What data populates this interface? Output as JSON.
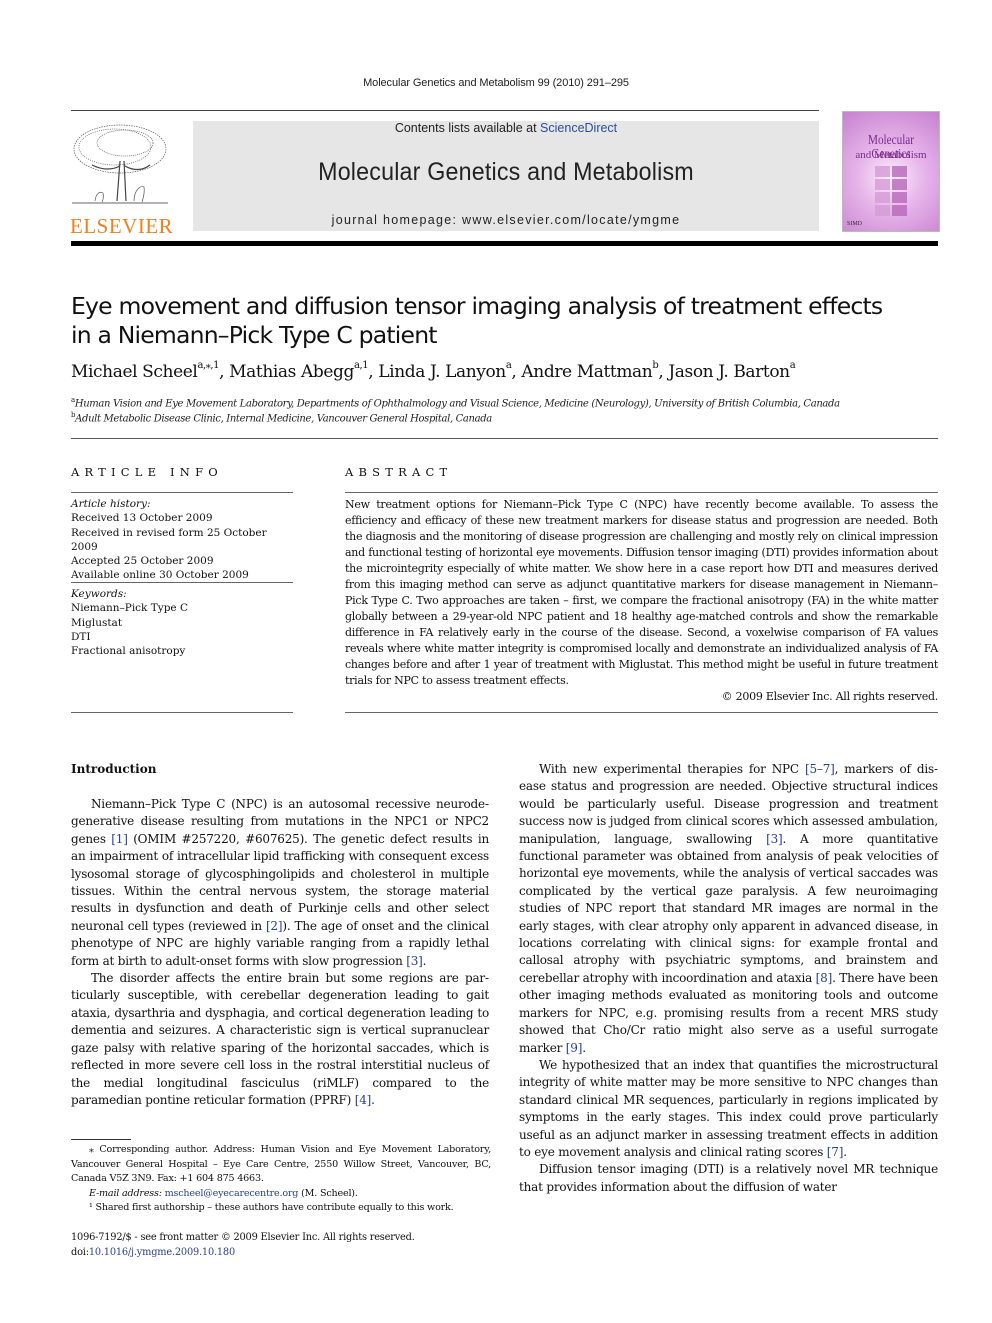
{
  "running_head": "Molecular Genetics and Metabolism 99 (2010) 291–295",
  "masthead": {
    "publisher_logo_text": "ELSEVIER",
    "contents_prefix": "Contents lists available at ",
    "contents_link": "ScienceDirect",
    "journal_title": "Molecular Genetics and Metabolism",
    "homepage": "journal homepage: www.elsevier.com/locate/ymgme",
    "cover": {
      "title_line1": "Molecular Genetics",
      "title_line2": "and Metabolism",
      "society": "SIMD",
      "accent_color": "#c77fd0"
    },
    "colors": {
      "elsevier_orange": "#f07f1e",
      "banner_gray": "#e6e6e6",
      "link_blue": "#2a3f8f"
    }
  },
  "article": {
    "title_line1": "Eye movement and diffusion tensor imaging analysis of treatment effects",
    "title_line2": "in a Niemann–Pick Type C patient",
    "authors": [
      {
        "name": "Michael Scheel",
        "sup": "a,⁎,1",
        "sep": ", "
      },
      {
        "name": "Mathias Abegg",
        "sup": "a,1",
        "sep": ", "
      },
      {
        "name": "Linda J. Lanyon",
        "sup": "a",
        "sep": ", "
      },
      {
        "name": "Andre Mattman",
        "sup": "b",
        "sep": ", "
      },
      {
        "name": "Jason J. Barton",
        "sup": "a",
        "sep": ""
      }
    ],
    "affiliations": [
      {
        "mark": "a",
        "text": "Human Vision and Eye Movement Laboratory, Departments of Ophthalmology and Visual Science, Medicine (Neurology), University of British Columbia, Canada"
      },
      {
        "mark": "b",
        "text": "Adult Metabolic Disease Clinic, Internal Medicine, Vancouver General Hospital, Canada"
      }
    ]
  },
  "article_info": {
    "heading": "ARTICLE INFO",
    "history_label": "Article history:",
    "history": [
      "Received 13 October 2009",
      "Received in revised form 25 October 2009",
      "Accepted 25 October 2009",
      "Available online 30 October 2009"
    ],
    "keywords_label": "Keywords:",
    "keywords": [
      "Niemann–Pick Type C",
      "Miglustat",
      "DTI",
      "Fractional anisotropy"
    ]
  },
  "abstract": {
    "heading": "ABSTRACT",
    "text": "New treatment options for Niemann–Pick Type C (NPC) have recently become available. To assess the efficiency and efficacy of these new treatment markers for disease status and progression are needed. Both the diagnosis and the monitoring of disease progression are challenging and mostly rely on clinical impression and functional testing of horizontal eye movements. Diffusion tensor imaging (DTI) provides information about the microintegrity especially of white matter. We show here in a case report how DTI and measures derived from this imaging method can serve as adjunct quantitative markers for disease management in Niemann–Pick Type C. Two approaches are taken – first, we compare the fractional anisotropy (FA) in the white matter globally between a 29-year-old NPC patient and 18 healthy age-matched controls and show the remarkable difference in FA relatively early in the course of the disease. Second, a voxelwise comparison of FA values reveals where white matter integrity is compromised locally and demonstrate an individualized analysis of FA changes before and after 1 year of treatment with Miglustat. This method might be useful in future treatment trials for NPC to assess treatment effects.",
    "copyright": "© 2009 Elsevier Inc. All rights reserved."
  },
  "body": {
    "intro_heading": "Introduction",
    "left_col": {
      "p1_a": "Niemann–Pick Type C (NPC) is an autosomal recessive neurode­generative disease resulting from mutations in the NPC1 or NPC2 genes ",
      "p1_ref1": "[1]",
      "p1_b": " (OMIM #257220, #607625). The genetic defect results in an impairment of intracellular lipid trafficking with consequent excess lysosomal storage of glycosphingolipids and cholesterol in multiple tissues. Within the central nervous system, the storage material results in dysfunction and death of Purkinje cells and other select neuronal cell types (reviewed in ",
      "p1_ref2": "[2]",
      "p1_c": "). The age of onset and the clinical phenotype of NPC are highly variable ranging from a rapidly lethal form at birth to adult-onset forms with slow pro­gression ",
      "p1_ref3": "[3]",
      "p1_d": ".",
      "p2_a": "The disorder affects the entire brain but some regions are par­ticularly susceptible, with cerebellar degeneration leading to gait ataxia, dysarthria and dysphagia, and cortical degeneration leading to dementia and seizures. A characteristic sign is vertical supranu­clear gaze palsy with relative sparing of the horizontal saccades, which is reflected in more severe cell loss in the rostral interstitial nucleus of the medial longitudinal fasciculus (riMLF) compared to the paramedian pontine reticular formation (PPRF) ",
      "p2_ref": "[4]",
      "p2_b": "."
    },
    "right_col": {
      "p1_a": "With new experimental therapies for NPC ",
      "p1_ref1": "[5–7]",
      "p1_b": ", markers of dis­ease status and progression are needed. Objective structural indi­ces would be particularly useful. Disease progression and treatment success now is judged from clinical scores which as­sessed ambulation, manipulation, language, swallowing ",
      "p1_ref2": "[3]",
      "p1_c": ". A more quantitative functional parameter was obtained from analy­sis of peak velocities of horizontal eye movements, while the anal­ysis of vertical saccades was complicated by the vertical gaze paralysis. A few neuroimaging studies of NPC report that standard MR images are normal in the early stages, with clear atrophy only apparent in advanced disease, in locations correlating with clinical signs: for example frontal and callosal atrophy with psychiatric symptoms, and brainstem and cerebellar atrophy with incoordina­tion and ataxia ",
      "p1_ref3": "[8]",
      "p1_d": ". There have been other imaging methods eval­uated as monitoring tools and outcome markers for NPC, e.g. promising results from a recent MRS study showed that Cho/Cr ra­tio might also serve as a useful surrogate marker ",
      "p1_ref4": "[9]",
      "p1_e": ".",
      "p2_a": "We hypothesized that an index that quantifies the microstruc­tural integrity of white matter may be more sensitive to NPC changes than standard clinical MR sequences, particularly in re­gions implicated by symptoms in the early stages. This index could prove particularly useful as an adjunct marker in assessing treat­ment effects in addition to eye movement analysis and clinical rat­ing scores ",
      "p2_ref": "[7]",
      "p2_b": ".",
      "p3": "Diffusion tensor imaging (DTI) is a relatively novel MR tech­nique that provides information about the diffusion of water"
    }
  },
  "footnotes": {
    "corresponding": "⁎  Corresponding author. Address: Human Vision and Eye Movement Laboratory, Vancouver General Hospital – Eye Care Centre, 2550 Willow Street, Vancouver, BC, Canada V5Z 3N9. Fax: +1 604 875 4663.",
    "email_label": "E-mail address: ",
    "email": "mscheel@eyecarecentre.org",
    "email_suffix": " (M. Scheel).",
    "shared": "¹  Shared first authorship – these authors have contribute equally to this work."
  },
  "issn_line": "1096-7192/$ - see front matter © 2009 Elsevier Inc. All rights reserved.",
  "doi_prefix": "doi:",
  "doi": "10.1016/j.ymgme.2009.10.180"
}
